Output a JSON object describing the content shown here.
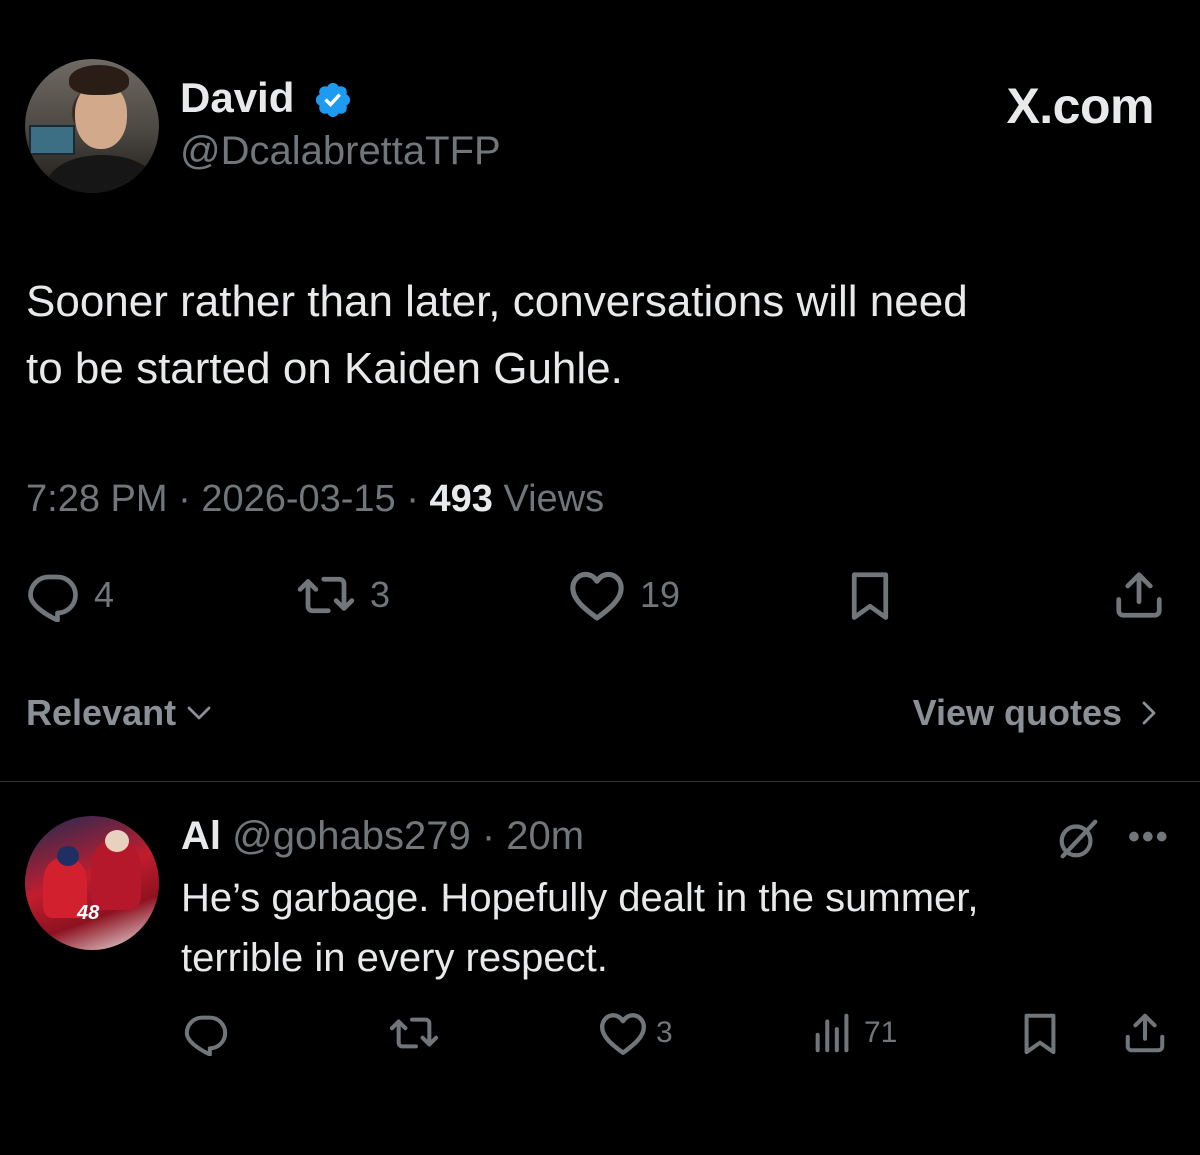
{
  "brand": {
    "label": "X.com"
  },
  "main_tweet": {
    "author": {
      "display_name": "David",
      "handle": "@DcalabrettaTFP",
      "verified": true
    },
    "text_line1": "Sooner rather than later, conversations will need",
    "text_line2": "to be started on Kaiden Guhle.",
    "time": "7:28 PM",
    "separator": "·",
    "date": "2026-03-15",
    "views_count": "493",
    "views_label": "Views",
    "actions": {
      "replies": "4",
      "reposts": "3",
      "likes": "19"
    },
    "icons": {
      "reply": "reply-icon",
      "repost": "repost-icon",
      "like": "heart-icon",
      "bookmark": "bookmark-icon",
      "share": "share-icon"
    }
  },
  "sort": {
    "label": "Relevant"
  },
  "view_quotes": {
    "label": "View quotes"
  },
  "reply": {
    "author": {
      "display_name": "Al",
      "handle": "@gohabs279",
      "time": "20m"
    },
    "avatar_jersey_number": "48",
    "text_line1": "He’s garbage. Hopefully dealt in the summer,",
    "text_line2": "terrible in every respect.",
    "actions": {
      "likes": "3",
      "views": "71"
    }
  },
  "colors": {
    "background": "#000000",
    "primary_text": "#e7e9ea",
    "secondary_text": "#71767b",
    "verified": "#1d9bf0",
    "divider": "#2f3336"
  }
}
